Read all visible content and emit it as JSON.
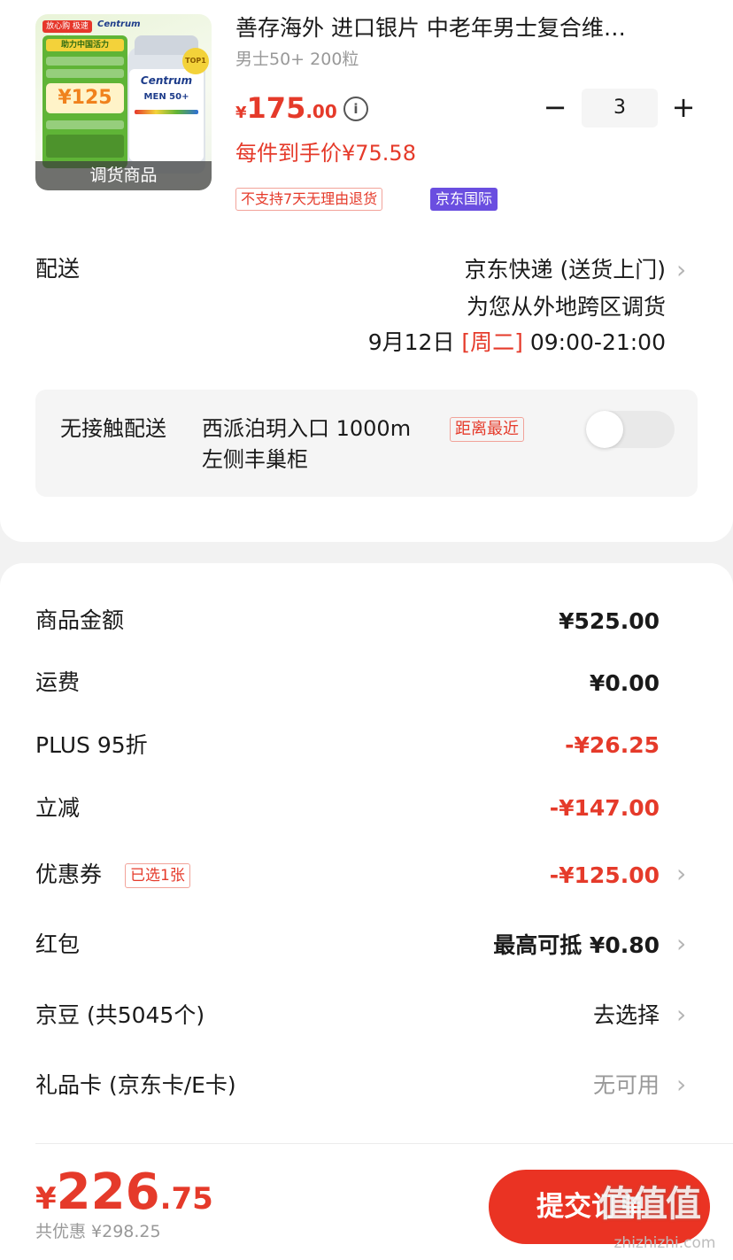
{
  "product": {
    "image": {
      "promo_tag": "放心购 极速达",
      "brand": "Centrum",
      "promo_head": "助力中国活力",
      "promo_price": "¥125",
      "bottle_brand": "Centrum",
      "bottle_line": "MEN 50+",
      "top_badge": "TOP1",
      "band_label": "调货商品"
    },
    "title": "善存海外 进口银片 中老年男士复合维…",
    "spec": "男士50+ 200粒",
    "price_symbol": "¥",
    "price_int": "175",
    "price_dec": ".00",
    "info_glyph": "i",
    "unit_price": "每件到手价¥75.58",
    "badges": {
      "no_return": "不支持7天无理由退货",
      "intl": "京东国际"
    },
    "quantity": {
      "minus": "−",
      "value": "3",
      "plus": "+"
    }
  },
  "delivery": {
    "label": "配送",
    "method": "京东快递 (送货上门)",
    "note": "为您从外地跨区调货",
    "date": "9月12日",
    "weekday": "[周二]",
    "time": "09:00-21:00",
    "chevron": "›"
  },
  "contactless": {
    "label": "无接触配送",
    "locker_address": "西派泊玥入口 1000m",
    "locker_location": "左侧丰巢柜",
    "nearest_badge": "距离最近",
    "enabled": false
  },
  "fees": {
    "goods_label": "商品金额",
    "goods_value": "¥525.00",
    "shipping_label": "运费",
    "shipping_value": "¥0.00",
    "plus_label": "PLUS 95折",
    "plus_value": "-¥26.25",
    "instant_label": "立减",
    "instant_value": "-¥147.00",
    "coupon_label": "优惠券",
    "coupon_badge": "已选1张",
    "coupon_value": "-¥125.00",
    "redpacket_label": "红包",
    "redpacket_value": "最高可抵 ¥0.80",
    "jingdou_label": "京豆 (共5045个)",
    "jingdou_value": "去选择",
    "giftcard_label": "礼品卡 (京东卡/E卡)",
    "giftcard_value": "无可用",
    "chevron": "›"
  },
  "footer": {
    "total_symbol": "¥",
    "total_int": "226",
    "total_dec": ".75",
    "saved": "共优惠 ¥298.25",
    "submit": "提交订单",
    "watermark": "值值值",
    "watermark_url": "zhizhizhi.com"
  },
  "colors": {
    "accent": "#e53a2a",
    "button": "#ea3323",
    "intl_badge": "#6a4ee0",
    "background": "#f2f2f2"
  }
}
